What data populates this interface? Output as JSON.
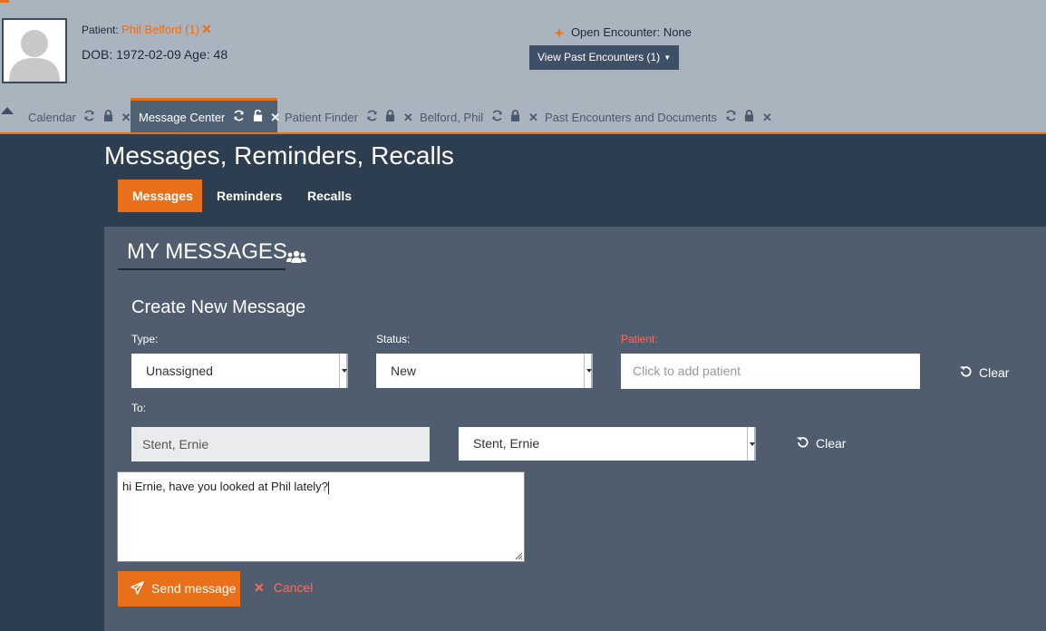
{
  "header": {
    "patient_label": "Patient:",
    "patient_name": "Phil Belford (1)",
    "patient_close": "✕",
    "dob_text": "DOB: 1972-02-09 Age: 48",
    "open_encounter_plus": "+",
    "open_encounter": "Open Encounter: None",
    "past_encounters_button": "View Past Encounters  (1)",
    "caret": "▼"
  },
  "tabs": [
    {
      "label": "Calendar",
      "active": false
    },
    {
      "label": "Message Center",
      "active": true
    },
    {
      "label": "Patient Finder",
      "active": false
    },
    {
      "label": "Belford, Phil",
      "active": false
    },
    {
      "label": "Past Encounters and Documents",
      "active": false
    }
  ],
  "page": {
    "title": "Messages, Reminders, Recalls",
    "nav": [
      "Messages",
      "Reminders",
      "Recalls"
    ],
    "section_title": "MY MESSAGES"
  },
  "form": {
    "title": "Create New Message",
    "type_label": "Type:",
    "type_value": "Unassigned",
    "status_label": "Status:",
    "status_value": "New",
    "patient_label": "Patient:",
    "patient_placeholder": "Click to add patient",
    "clear_label": "Clear",
    "to_label": "To:",
    "to_value": "Stent, Ernie",
    "to_select_value": "Stent, Ernie",
    "message_text": "hi Ernie, have you looked at Phil lately?",
    "send_label": "Send message",
    "cancel_icon": "✕",
    "cancel_label": "Cancel"
  },
  "colors": {
    "accent": "#e8701a",
    "header_bg": "#aab4bf",
    "page_bg": "#2c3e50",
    "panel_bg": "#4f5d6e",
    "danger": "#ff6b5a"
  }
}
